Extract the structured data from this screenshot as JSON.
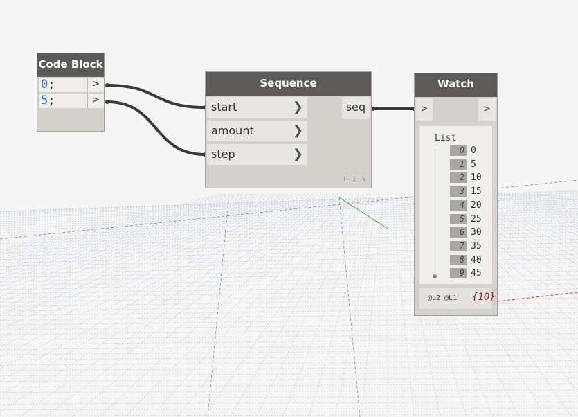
{
  "colors": {
    "header_bg": "#5c5a57",
    "node_body": "#d4d1cb",
    "wire": "#3a3a3a",
    "code_number": "#2b6cd6",
    "watch_count": "#8b2a2a",
    "grid": "#b9cad3"
  },
  "code_block": {
    "title": "Code Block",
    "lines": [
      {
        "num": "0",
        "suffix": ";",
        "port": ">"
      },
      {
        "num": "5",
        "suffix": ";",
        "port": ">"
      }
    ]
  },
  "sequence": {
    "title": "Sequence",
    "inputs": [
      {
        "label": "start",
        "chevron": "❯"
      },
      {
        "label": "amount",
        "chevron": "❯"
      },
      {
        "label": "step",
        "chevron": "❯"
      }
    ],
    "output": "seq",
    "lacing": "I I \\"
  },
  "watch": {
    "title": "Watch",
    "in_port": ">",
    "out_port": ">",
    "list_label": "List",
    "items": [
      {
        "index": "0",
        "value": "0"
      },
      {
        "index": "1",
        "value": "5"
      },
      {
        "index": "2",
        "value": "10"
      },
      {
        "index": "3",
        "value": "15"
      },
      {
        "index": "4",
        "value": "20"
      },
      {
        "index": "5",
        "value": "25"
      },
      {
        "index": "6",
        "value": "30"
      },
      {
        "index": "7",
        "value": "35"
      },
      {
        "index": "8",
        "value": "40"
      },
      {
        "index": "9",
        "value": "45"
      }
    ],
    "levels": "@L2 @L1",
    "count": "{10}"
  }
}
